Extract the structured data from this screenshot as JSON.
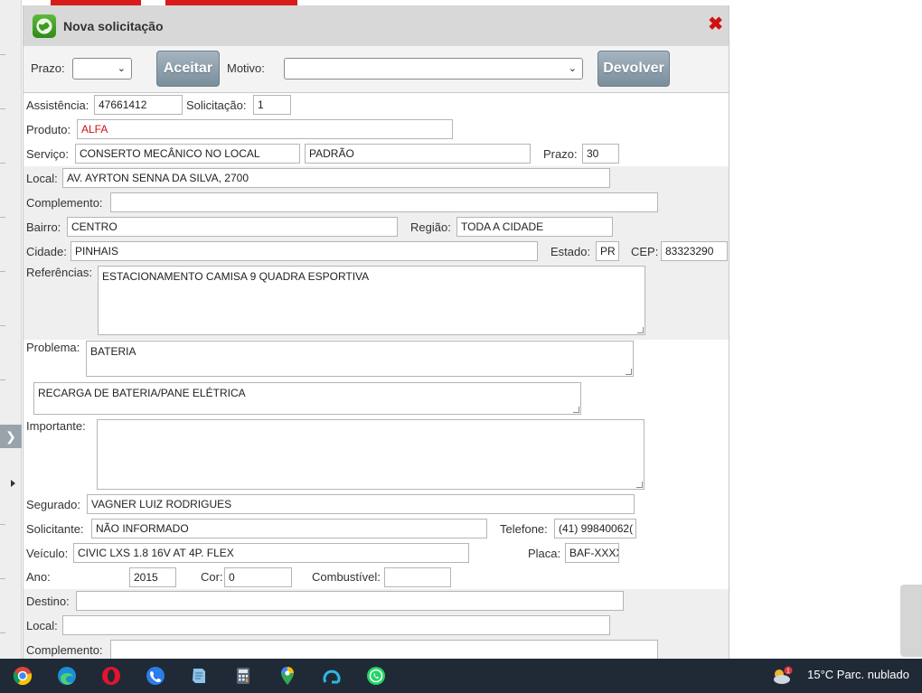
{
  "dialog": {
    "title": "Nova solicitação"
  },
  "toolbar": {
    "prazo_label": "Prazo:",
    "prazo_value": "",
    "aceitar_label": "Aceitar",
    "motivo_label": "Motivo:",
    "motivo_value": "",
    "devolver_label": "Devolver"
  },
  "form": {
    "assistencia_label": "Assistência:",
    "assistencia": "47661412",
    "solicitacao_label": "Solicitação:",
    "solicitacao": "1",
    "produto_label": "Produto:",
    "produto": "ALFA",
    "servico_label": "Serviço:",
    "servico": "CONSERTO MECÂNICO NO LOCAL",
    "servico_tipo": "PADRÃO",
    "prazo_label": "Prazo:",
    "prazo": "30",
    "local_label": "Local:",
    "local": "AV. AYRTON SENNA DA SILVA, 2700",
    "complemento_label": "Complemento:",
    "complemento": "",
    "bairro_label": "Bairro:",
    "bairro": "CENTRO",
    "regiao_label": "Região:",
    "regiao": "TODA A CIDADE",
    "cidade_label": "Cidade:",
    "cidade": "PINHAIS",
    "estado_label": "Estado:",
    "estado": "PR",
    "cep_label": "CEP:",
    "cep": "83323290",
    "referencias_label": "Referências:",
    "referencias": "ESTACIONAMENTO CAMISA 9 QUADRA ESPORTIVA",
    "problema_label": "Problema:",
    "problema": "BATERIA",
    "problema_detalhe": "RECARGA DE BATERIA/PANE ELÉTRICA",
    "importante_label": "Importante:",
    "importante": "",
    "segurado_label": "Segurado:",
    "segurado": "VAGNER LUIZ RODRIGUES",
    "solicitante_label": "Solicitante:",
    "solicitante": "NÃO INFORMADO",
    "telefone_label": "Telefone:",
    "telefone": "(41) 99840062(",
    "veiculo_label": "Veículo:",
    "veiculo": "CIVIC LXS 1.8 16V AT 4P. FLEX",
    "placa_label": "Placa:",
    "placa": "BAF-XXXX",
    "ano_label": "Ano:",
    "ano": "2015",
    "cor_label": "Cor:",
    "cor": "0",
    "combustivel_label": "Combustível:",
    "combustivel": "",
    "destino_label": "Destino:",
    "destino": "",
    "destino_local_label": "Local:",
    "destino_local": "",
    "destino_complemento_label": "Complemento:",
    "destino_complemento": ""
  },
  "taskbar": {
    "apps": [
      "chrome-icon",
      "edge-icon",
      "opera-icon",
      "phone-app-icon",
      "notes-app-icon",
      "calculator-icon",
      "maps-icon",
      "arc-app-icon",
      "whatsapp-icon"
    ],
    "weather_badge": "1",
    "weather_text": "15°C  Parc. nublado"
  },
  "colors": {
    "accent_red": "#d01010",
    "button": "#8a9aa8",
    "taskbar": "#1f2a36"
  }
}
